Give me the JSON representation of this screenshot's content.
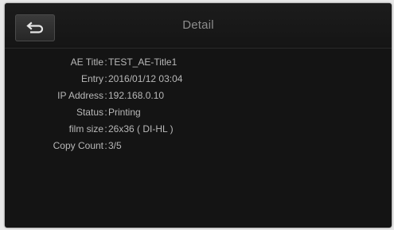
{
  "header": {
    "title": "Detail",
    "back_icon": "return-arrow-icon"
  },
  "details": [
    {
      "label": "AE Title",
      "value": "TEST_AE-Title1"
    },
    {
      "label": "Entry",
      "value": "2016/01/12 03:04"
    },
    {
      "label": "IP Address",
      "value": "192.168.0.10"
    },
    {
      "label": "Status",
      "value": "Printing"
    },
    {
      "label": "film size",
      "value": "26x36 ( DI-HL )"
    },
    {
      "label": "Copy Count",
      "value": "3/5"
    }
  ],
  "separator": ":"
}
